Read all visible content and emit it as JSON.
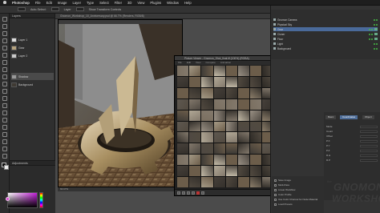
{
  "menubar": {
    "app": "Photoshop",
    "items": [
      "File",
      "Edit",
      "Image",
      "Layer",
      "Type",
      "Select",
      "Filter",
      "3D",
      "View",
      "Plugins",
      "Window",
      "Help"
    ]
  },
  "options": {
    "items": [
      "Auto-Select:",
      "Layer",
      "Show Transform Controls"
    ]
  },
  "layers": {
    "title": "Layers",
    "items": [
      {
        "name": "Layer 1"
      },
      {
        "name": "Gear"
      },
      {
        "name": "Layer 2"
      },
      {
        "name": "Shadow"
      },
      {
        "name": "Background"
      }
    ]
  },
  "adjustments": {
    "title": "Adjustments"
  },
  "document": {
    "tab": "Gnomon_Workshop_10_Anniversary.psd @ 66.7% (Renders, RGB/8)",
    "status": "66.67%"
  },
  "viewer": {
    "title": "Picture Viewer - Gnomon_Shot_final.tif (100%) (RGBA)",
    "menu": [
      "File",
      "Edit",
      "View",
      "Compare",
      "Animation"
    ]
  },
  "objects": {
    "rows": [
      {
        "name": "Gnomon Camera"
      },
      {
        "name": "Physical Sky"
      },
      {
        "name": "Gear"
      },
      {
        "name": "Cloner"
      },
      {
        "name": "Floor"
      },
      {
        "name": "Light"
      },
      {
        "name": "Background"
      }
    ]
  },
  "attributes": {
    "tabs": [
      "Basic",
      "Coordinates",
      "Object"
    ],
    "rows": [
      {
        "label": "Mode"
      },
      {
        "label": "Count"
      },
      {
        "label": "Offset"
      },
      {
        "label": "P.X"
      },
      {
        "label": "P.Y"
      },
      {
        "label": "P.Z"
      },
      {
        "label": "R.H"
      },
      {
        "label": "R.P"
      }
    ]
  },
  "render_settings": {
    "rows": [
      "Save Image",
      "Multi-Pass",
      "Linear Workflow",
      "Color Profile",
      "Use Color Channel for Node Material",
      "Load Presets"
    ]
  },
  "logo": {
    "pre": "the",
    "line1": "GNOMON",
    "line2": "WORKSHOP"
  },
  "colors": {
    "ui_dark": "#2a2a2a",
    "selection_blue": "#4f6e99",
    "foreground_swatch": "#d64fd0"
  }
}
